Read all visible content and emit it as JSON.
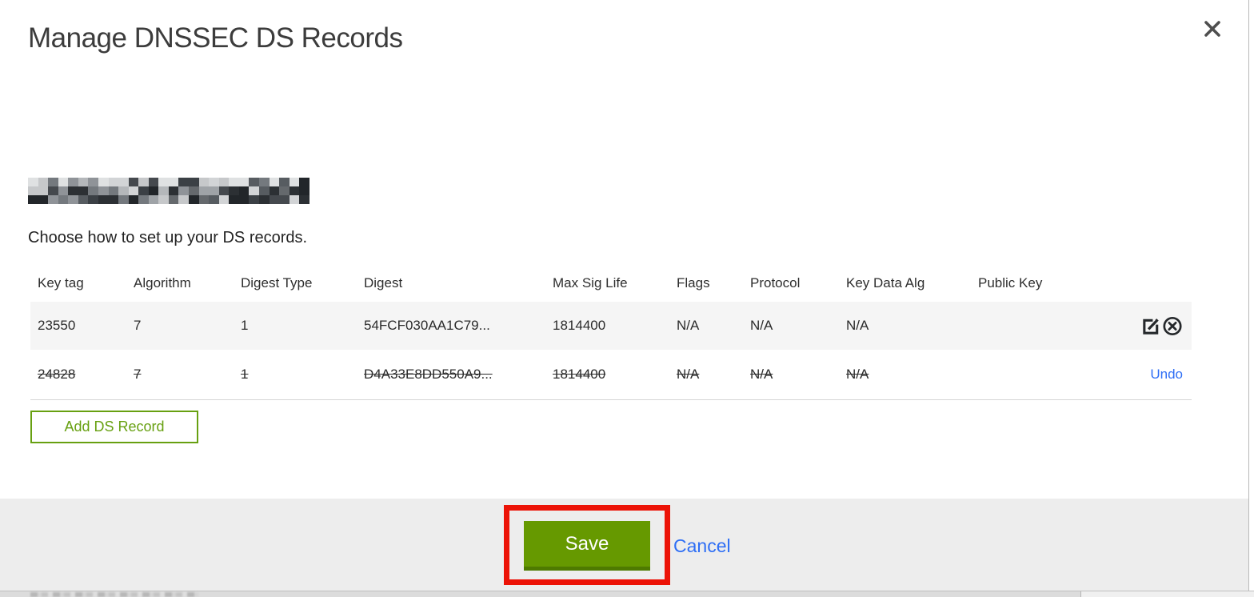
{
  "modal": {
    "title": "Manage DNSSEC DS Records",
    "domain_redacted": true,
    "instruction": "Choose how to set up your DS records.",
    "table": {
      "columns": [
        "Key tag",
        "Algorithm",
        "Digest Type",
        "Digest",
        "Max Sig Life",
        "Flags",
        "Protocol",
        "Key Data Alg",
        "Public Key"
      ],
      "rows": [
        {
          "key_tag": "23550",
          "algorithm": "7",
          "digest_type": "1",
          "digest": "54FCF030AA1C79...",
          "max_sig_life": "1814400",
          "flags": "N/A",
          "protocol": "N/A",
          "key_data_alg": "N/A",
          "public_key": "",
          "state": "active",
          "actions": [
            "edit",
            "delete"
          ]
        },
        {
          "key_tag": "24828",
          "algorithm": "7",
          "digest_type": "1",
          "digest": "D4A33E8DD550A9...",
          "max_sig_life": "1814400",
          "flags": "N/A",
          "protocol": "N/A",
          "key_data_alg": "N/A",
          "public_key": "",
          "state": "marked-for-deletion",
          "action_label": "Undo"
        }
      ]
    },
    "add_button_label": "Add DS Record",
    "footer": {
      "save_label": "Save",
      "cancel_label": "Cancel"
    },
    "annotation": {
      "type": "highlight-box",
      "color": "#ec1307",
      "target": "save-button"
    },
    "colors": {
      "save_green": "#669900",
      "add_outline_green": "#67a011",
      "link_blue": "#2e6ef5",
      "annotation_red": "#ec1307",
      "row_alt_gray": "#f5f5f5",
      "footer_gray": "#ededed"
    }
  }
}
